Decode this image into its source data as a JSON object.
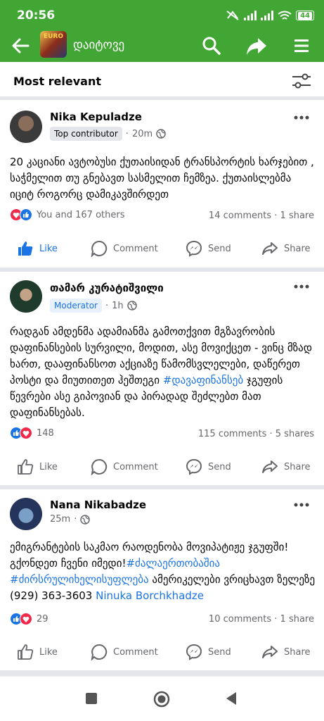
{
  "status_bar": {
    "time": "20:56",
    "battery": "44",
    "icons": [
      "data-off-icon",
      "signal-icon",
      "signal-icon",
      "wifi-icon",
      "battery-icon"
    ]
  },
  "app_bar": {
    "group_title": "დაიტოვე",
    "thumb_text": "EURO",
    "actions": [
      "search-icon",
      "share-icon",
      "menu-icon"
    ],
    "brand_color": "#42a635"
  },
  "sort": {
    "label": "Most relevant"
  },
  "actions_labels": {
    "like": "Like",
    "comment": "Comment",
    "send": "Send",
    "share": "Share"
  },
  "posts": [
    {
      "author": "Nika Kepuladze",
      "badge": "Top contributor",
      "time": "20m",
      "text": "20 კაციანი ავტობუსი ქუთაისიდან ტრანსპორტის ხარჯებით , საჭმელით თუ გნებავთ სასმელით ჩემზეა. ქუთაისლებმა იციტ როგორც დამიკავშირდეთ",
      "reactions_text": "You and 167 others",
      "comments": "14 comments",
      "shares": "1 share",
      "liked": true
    },
    {
      "author": "თამარ კურატიშვილი",
      "badge": "Moderator",
      "time": "1h",
      "text_before": "რადგან ამდენმა ადამიანმა გამოთქვით მგზავრობის დაფინანსების სურვილი, მოდით, ასე მოვიქცეთ - ვინც მზად ხართ, დააფინანსოთ აქციაზე წამომსვლელები, დაწერეთ პოსტი და მიუთითეთ ჰეშთეგი ",
      "hashtag": "#დავაფინანსებ",
      "text_after": " ჯგუფის წევრები ასე გიპოვიან და პირადად შეძლებთ მათ დაფინანსებას.",
      "reactions_text": "148",
      "comments": "115 comments",
      "shares": "5 shares",
      "liked": false
    },
    {
      "author": "Nana Nikabadze",
      "time": "25m",
      "text_before": "ემიგრანტების საკმაო რაოდენობა მოვიპატიჟე ჯგუფში! გქონდეთ ჩვენი იმედი!",
      "hashtag1": "#ძალაერთობაშია",
      "hashtag2": "#ძირსრულიხელისუფლება",
      "text_mid": " ამერიკელები ვრიცხავთ ზელეზე (929) 363-3603 ",
      "mention": "Ninuka Borchkhadze",
      "reactions_text": "29",
      "comments": "10 comments",
      "shares": "1 share",
      "liked": false
    }
  ],
  "colors": {
    "link": "#1b74e4",
    "like_blue": "#1b74e4",
    "love_red": "#f02849",
    "secondary_text": "#65676b"
  }
}
